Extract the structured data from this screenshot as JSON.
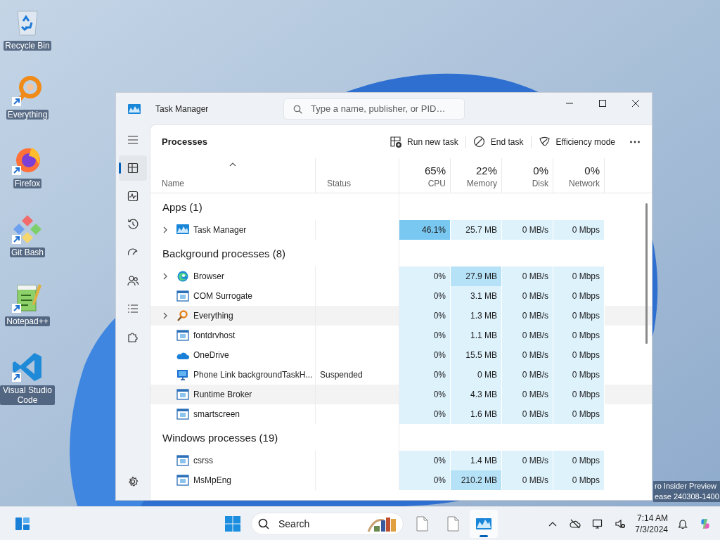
{
  "desktop": {
    "icons": [
      {
        "kind": "recycle",
        "label": "Recycle Bin",
        "shortcut": false
      },
      {
        "kind": "everything",
        "label": "Everything",
        "shortcut": true
      },
      {
        "kind": "firefox",
        "label": "Firefox",
        "shortcut": true
      },
      {
        "kind": "gitbash",
        "label": "Git Bash",
        "shortcut": true
      },
      {
        "kind": "notepad",
        "label": "Notepad++",
        "shortcut": true
      },
      {
        "kind": "vscode",
        "label": "Visual Studio Code",
        "shortcut": true
      }
    ],
    "watermark": [
      "ro Insider Preview",
      "ease 240308-1400"
    ]
  },
  "window": {
    "title": "Task Manager",
    "search": {
      "placeholder": "Type a name, publisher, or PID…"
    },
    "nav": [
      {
        "kind": "menu",
        "selected": false
      },
      {
        "kind": "processes",
        "selected": true
      },
      {
        "kind": "performance",
        "selected": false
      },
      {
        "kind": "history",
        "selected": false
      },
      {
        "kind": "startup",
        "selected": false
      },
      {
        "kind": "users",
        "selected": false
      },
      {
        "kind": "details",
        "selected": false
      },
      {
        "kind": "services",
        "selected": false
      },
      {
        "kind": "settings",
        "selected": false
      }
    ],
    "page": {
      "title": "Processes",
      "actions": [
        {
          "kind": "run",
          "label": "Run new task"
        },
        {
          "kind": "end",
          "label": "End task"
        },
        {
          "kind": "efficiency",
          "label": "Efficiency mode"
        },
        {
          "kind": "more"
        }
      ]
    },
    "table": {
      "columns": [
        {
          "label": "Name",
          "sorted": true
        },
        {
          "label": "Status",
          "sorted": false
        },
        {
          "label": "CPU",
          "total": "65%",
          "sorted": false
        },
        {
          "label": "Memory",
          "total": "22%",
          "sorted": false
        },
        {
          "label": "Disk",
          "total": "0%",
          "sorted": false
        },
        {
          "label": "Network",
          "total": "0%",
          "sorted": false
        }
      ],
      "groups": [
        {
          "title": "Apps (1)",
          "rows": [
            {
              "kind": "taskmgr",
              "name": "Task Manager",
              "expandable": true,
              "highlighted": false,
              "values": [
                {
                  "text": "46.1%",
                  "color": "#79c8f1"
                },
                {
                  "text": "25.7 MB",
                  "color": "#def2fc"
                },
                {
                  "text": "0 MB/s",
                  "color": "#def2fc"
                },
                {
                  "text": "0 Mbps",
                  "color": "#def2fc"
                }
              ]
            }
          ]
        },
        {
          "title": "Background processes (8)",
          "rows": [
            {
              "kind": "edge",
              "name": "Browser",
              "expandable": true,
              "highlighted": false,
              "values": [
                {
                  "text": "0%",
                  "color": "#def2fc"
                },
                {
                  "text": "27.9 MB",
                  "color": "#b6e2f8"
                },
                {
                  "text": "0 MB/s",
                  "color": "#def2fc"
                },
                {
                  "text": "0 Mbps",
                  "color": "#def2fc"
                }
              ]
            },
            {
              "kind": "app",
              "name": "COM Surrogate",
              "expandable": false,
              "highlighted": false,
              "values": [
                {
                  "text": "0%",
                  "color": "#def2fc"
                },
                {
                  "text": "3.1 MB",
                  "color": "#def2fc"
                },
                {
                  "text": "0 MB/s",
                  "color": "#def2fc"
                },
                {
                  "text": "0 Mbps",
                  "color": "#def2fc"
                }
              ]
            },
            {
              "kind": "everything",
              "name": "Everything",
              "expandable": true,
              "highlighted": true,
              "values": [
                {
                  "text": "0%",
                  "color": "#def2fc"
                },
                {
                  "text": "1.3 MB",
                  "color": "#def2fc"
                },
                {
                  "text": "0 MB/s",
                  "color": "#def2fc"
                },
                {
                  "text": "0 Mbps",
                  "color": "#def2fc"
                }
              ]
            },
            {
              "kind": "app",
              "name": "fontdrvhost",
              "expandable": false,
              "highlighted": false,
              "values": [
                {
                  "text": "0%",
                  "color": "#def2fc"
                },
                {
                  "text": "1.1 MB",
                  "color": "#def2fc"
                },
                {
                  "text": "0 MB/s",
                  "color": "#def2fc"
                },
                {
                  "text": "0 Mbps",
                  "color": "#def2fc"
                }
              ]
            },
            {
              "kind": "onedrive",
              "name": "OneDrive",
              "expandable": false,
              "highlighted": false,
              "values": [
                {
                  "text": "0%",
                  "color": "#def2fc"
                },
                {
                  "text": "15.5 MB",
                  "color": "#def2fc"
                },
                {
                  "text": "0 MB/s",
                  "color": "#def2fc"
                },
                {
                  "text": "0 Mbps",
                  "color": "#def2fc"
                }
              ]
            },
            {
              "kind": "phonelink",
              "name": "Phone Link backgroundTaskH...",
              "status": "Suspended",
              "expandable": false,
              "highlighted": false,
              "values": [
                {
                  "text": "0%",
                  "color": "#def2fc"
                },
                {
                  "text": "0 MB",
                  "color": "#def2fc"
                },
                {
                  "text": "0 MB/s",
                  "color": "#def2fc"
                },
                {
                  "text": "0 Mbps",
                  "color": "#def2fc"
                }
              ]
            },
            {
              "kind": "app",
              "name": "Runtime Broker",
              "expandable": false,
              "highlighted": true,
              "values": [
                {
                  "text": "0%",
                  "color": "#def2fc"
                },
                {
                  "text": "4.3 MB",
                  "color": "#def2fc"
                },
                {
                  "text": "0 MB/s",
                  "color": "#def2fc"
                },
                {
                  "text": "0 Mbps",
                  "color": "#def2fc"
                }
              ]
            },
            {
              "kind": "app",
              "name": "smartscreen",
              "expandable": false,
              "highlighted": false,
              "values": [
                {
                  "text": "0%",
                  "color": "#def2fc"
                },
                {
                  "text": "1.6 MB",
                  "color": "#def2fc"
                },
                {
                  "text": "0 MB/s",
                  "color": "#def2fc"
                },
                {
                  "text": "0 Mbps",
                  "color": "#def2fc"
                }
              ]
            }
          ]
        },
        {
          "title": "Windows processes (19)",
          "rows": [
            {
              "kind": "app",
              "name": "csrss",
              "expandable": false,
              "highlighted": false,
              "values": [
                {
                  "text": "0%",
                  "color": "#def2fc"
                },
                {
                  "text": "1.4 MB",
                  "color": "#def2fc"
                },
                {
                  "text": "0 MB/s",
                  "color": "#def2fc"
                },
                {
                  "text": "0 Mbps",
                  "color": "#def2fc"
                }
              ]
            },
            {
              "kind": "app",
              "name": "MsMpEng",
              "expandable": false,
              "highlighted": false,
              "values": [
                {
                  "text": "0%",
                  "color": "#def2fc"
                },
                {
                  "text": "210.2 MB",
                  "color": "#b6e2f8"
                },
                {
                  "text": "0 MB/s",
                  "color": "#def2fc"
                },
                {
                  "text": "0 Mbps",
                  "color": "#def2fc"
                }
              ]
            }
          ]
        }
      ]
    }
  },
  "taskbar": {
    "search": {
      "placeholder": "Search"
    },
    "apps": [
      {
        "kind": "file",
        "active": false
      },
      {
        "kind": "file",
        "active": false
      },
      {
        "kind": "taskmgr",
        "active": true
      }
    ],
    "clock": {
      "time": "7:14 AM",
      "date": "7/3/2024"
    }
  }
}
